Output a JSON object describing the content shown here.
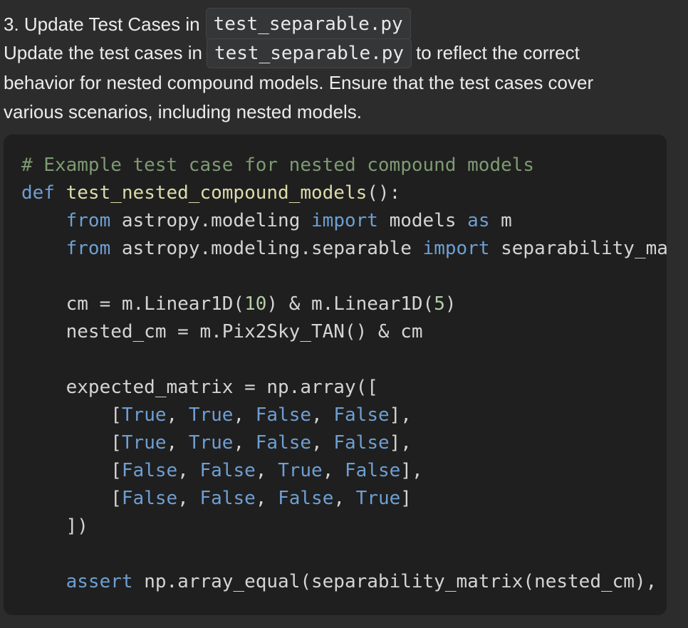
{
  "heading": {
    "text": "3. Update Test Cases in",
    "code": "test_separable.py"
  },
  "paragraph": {
    "before_code": "Update the test cases in",
    "code": "test_separable.py",
    "after_code": "to reflect the correct",
    "line2": "behavior for nested compound models. Ensure that the test cases cover",
    "line3": "various scenarios, including nested models."
  },
  "code_block": {
    "language": "python",
    "lines": [
      [
        {
          "t": "comment",
          "v": "# Example test case for nested compound models"
        }
      ],
      [
        {
          "t": "kw",
          "v": "def"
        },
        {
          "t": "plain",
          "v": " "
        },
        {
          "t": "fn",
          "v": "test_nested_compound_models"
        },
        {
          "t": "plain",
          "v": "():"
        }
      ],
      [
        {
          "t": "plain",
          "v": "    "
        },
        {
          "t": "kw",
          "v": "from"
        },
        {
          "t": "plain",
          "v": " astropy.modeling "
        },
        {
          "t": "kw",
          "v": "import"
        },
        {
          "t": "plain",
          "v": " models "
        },
        {
          "t": "kw",
          "v": "as"
        },
        {
          "t": "plain",
          "v": " m"
        }
      ],
      [
        {
          "t": "plain",
          "v": "    "
        },
        {
          "t": "kw",
          "v": "from"
        },
        {
          "t": "plain",
          "v": " astropy.modeling.separable "
        },
        {
          "t": "kw",
          "v": "import"
        },
        {
          "t": "plain",
          "v": " separability_ma"
        }
      ],
      [],
      [
        {
          "t": "plain",
          "v": "    cm = m.Linear1D("
        },
        {
          "t": "num",
          "v": "10"
        },
        {
          "t": "plain",
          "v": ") & m.Linear1D("
        },
        {
          "t": "num",
          "v": "5"
        },
        {
          "t": "plain",
          "v": ")"
        }
      ],
      [
        {
          "t": "plain",
          "v": "    nested_cm = m.Pix2Sky_TAN() & cm"
        }
      ],
      [],
      [
        {
          "t": "plain",
          "v": "    expected_matrix = np.array(["
        }
      ],
      [
        {
          "t": "plain",
          "v": "        ["
        },
        {
          "t": "const",
          "v": "True"
        },
        {
          "t": "plain",
          "v": ", "
        },
        {
          "t": "const",
          "v": "True"
        },
        {
          "t": "plain",
          "v": ", "
        },
        {
          "t": "const",
          "v": "False"
        },
        {
          "t": "plain",
          "v": ", "
        },
        {
          "t": "const",
          "v": "False"
        },
        {
          "t": "plain",
          "v": "],"
        }
      ],
      [
        {
          "t": "plain",
          "v": "        ["
        },
        {
          "t": "const",
          "v": "True"
        },
        {
          "t": "plain",
          "v": ", "
        },
        {
          "t": "const",
          "v": "True"
        },
        {
          "t": "plain",
          "v": ", "
        },
        {
          "t": "const",
          "v": "False"
        },
        {
          "t": "plain",
          "v": ", "
        },
        {
          "t": "const",
          "v": "False"
        },
        {
          "t": "plain",
          "v": "],"
        }
      ],
      [
        {
          "t": "plain",
          "v": "        ["
        },
        {
          "t": "const",
          "v": "False"
        },
        {
          "t": "plain",
          "v": ", "
        },
        {
          "t": "const",
          "v": "False"
        },
        {
          "t": "plain",
          "v": ", "
        },
        {
          "t": "const",
          "v": "True"
        },
        {
          "t": "plain",
          "v": ", "
        },
        {
          "t": "const",
          "v": "False"
        },
        {
          "t": "plain",
          "v": "],"
        }
      ],
      [
        {
          "t": "plain",
          "v": "        ["
        },
        {
          "t": "const",
          "v": "False"
        },
        {
          "t": "plain",
          "v": ", "
        },
        {
          "t": "const",
          "v": "False"
        },
        {
          "t": "plain",
          "v": ", "
        },
        {
          "t": "const",
          "v": "False"
        },
        {
          "t": "plain",
          "v": ", "
        },
        {
          "t": "const",
          "v": "True"
        },
        {
          "t": "plain",
          "v": "]"
        }
      ],
      [
        {
          "t": "plain",
          "v": "    ])"
        }
      ],
      [],
      [
        {
          "t": "plain",
          "v": "    "
        },
        {
          "t": "kw",
          "v": "assert"
        },
        {
          "t": "plain",
          "v": " np.array_equal(separability_matrix(nested_cm),"
        }
      ]
    ]
  },
  "colors": {
    "background": "#2c2c2c",
    "code_background": "#1f1f1f",
    "keyword": "#6e9fd3",
    "comment": "#7e9a72",
    "function": "#dcdcaa",
    "number": "#b5cea8"
  }
}
